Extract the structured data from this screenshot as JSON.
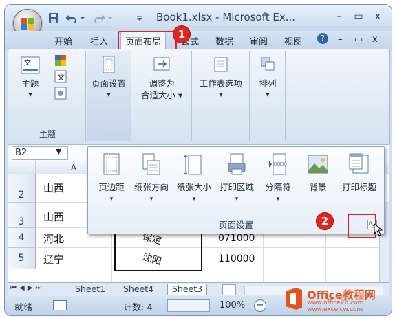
{
  "window": {
    "title": "Book1.xlsx - Microsoft Ex...",
    "controls": {
      "minimize": "–",
      "restore": "▭",
      "close": "x"
    }
  },
  "ribbon_tabs": [
    "开始",
    "插入",
    "页面布局",
    "公式",
    "数据",
    "审阅",
    "视图"
  ],
  "ribbon_tab_controls": {
    "help": "?",
    "minimize": "–",
    "restore": "▭",
    "close": "x"
  },
  "ribbon": {
    "theme_group": {
      "button": "主题",
      "label": "主题"
    },
    "page_setup_button": "页面设置",
    "scale_button": [
      "调整为",
      "合适大小"
    ],
    "sheet_options_button": "工作表选项",
    "arrange_button": "排列"
  },
  "formula_bar": {
    "name_box": "B2"
  },
  "popup": {
    "label": "页面设置",
    "buttons": [
      "页边距",
      "纸张方向",
      "纸张大小",
      "打印区域",
      "分隔符",
      "背景",
      "打印标题"
    ]
  },
  "annotations": {
    "badge1": "1",
    "badge2": "2"
  },
  "sheet": {
    "columns": [
      "A"
    ],
    "rows": [
      {
        "num": "2",
        "a": "山西",
        "b": "",
        "c": ""
      },
      {
        "num": "3",
        "a": "山西",
        "b": "",
        "c": ""
      },
      {
        "num": "4",
        "a": "河北",
        "b": "保定",
        "c": "071000"
      },
      {
        "num": "5",
        "a": "辽宁",
        "b": "沈阳",
        "c": "110000"
      }
    ]
  },
  "sheet_tabs": [
    "Sheet1",
    "Sheet4",
    "Sheet3"
  ],
  "status_bar": {
    "ready": "就绪",
    "count": "计数: 4",
    "zoom": "100%"
  },
  "watermark": {
    "brand": "Office教程网",
    "url": "www.office26.com",
    "url2": "www.excelcw.com"
  }
}
